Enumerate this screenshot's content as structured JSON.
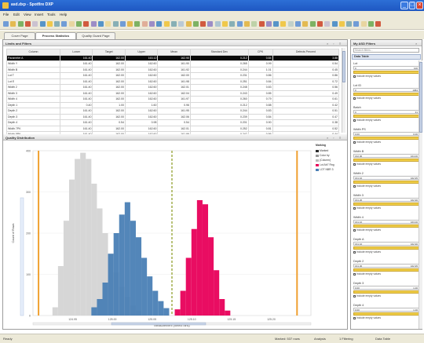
{
  "window": {
    "title": "asd.dxp - Spotfire DXP",
    "min": "_",
    "max": "□",
    "close": "×"
  },
  "menu": [
    "File",
    "Edit",
    "View",
    "Insert",
    "Tools",
    "Help"
  ],
  "tabs": [
    {
      "label": "Cover Page",
      "active": false
    },
    {
      "label": "Process Statistics",
      "active": true
    },
    {
      "label": "Quality Guard Page",
      "active": false
    }
  ],
  "table_panel": {
    "title": "Limits and Filters",
    "controls": [
      "×",
      "▫",
      "≡"
    ],
    "columns": [
      "Column",
      "Lower",
      "Target",
      "Upper",
      "Mean",
      "Standard Dev",
      "CPK",
      "Defects Percent"
    ],
    "rows": [
      [
        "Parameter A",
        "161.40",
        "162.00",
        "163.12",
        "162.90",
        "0.212",
        "0.84",
        "3.88"
      ],
      [
        "Width Y",
        "161.40",
        "162.00",
        "162.60",
        "161.90",
        "0.265",
        "0.99",
        "0.54"
      ],
      [
        "Width B",
        "161.40",
        "162.00",
        "162.60",
        "161.92",
        "0.244",
        "1.01",
        "0.45"
      ],
      [
        "Lot T",
        "161.40",
        "162.00",
        "162.60",
        "162.00",
        "0.231",
        "0.86",
        "0.86"
      ],
      [
        "Lot E",
        "161.40",
        "162.00",
        "162.60",
        "161.98",
        "0.251",
        "0.84",
        "0.72"
      ],
      [
        "Width 2",
        "161.40",
        "162.00",
        "162.60",
        "162.01",
        "0.248",
        "0.83",
        "0.56"
      ],
      [
        "Width 3",
        "161.40",
        "162.00",
        "162.60",
        "162.04",
        "0.243",
        "0.85",
        "0.49"
      ],
      [
        "Width 4",
        "161.40",
        "162.00",
        "162.60",
        "161.97",
        "0.260",
        "0.79",
        "0.61"
      ],
      [
        "Depth 1",
        "0.40",
        "1.00",
        "1.60",
        "0.96",
        "0.212",
        "0.88",
        "0.42"
      ],
      [
        "Depth 2",
        "161.40",
        "162.00",
        "162.60",
        "161.95",
        "0.244",
        "0.83",
        "0.51"
      ],
      [
        "Depth 3",
        "161.40",
        "162.00",
        "162.60",
        "162.06",
        "0.239",
        "0.84",
        "0.47"
      ],
      [
        "Depth 4",
        "161.40",
        "0.54",
        "0.98",
        "0.54",
        "0.201",
        "0.90",
        "0.38"
      ],
      [
        "Width 7PK",
        "161.40",
        "162.00",
        "162.60",
        "162.01",
        "0.252",
        "0.81",
        "0.52"
      ],
      [
        "Width 8PK",
        "161.40",
        "162.00",
        "162.60",
        "161.99",
        "0.247",
        "0.86",
        "0.44"
      ]
    ]
  },
  "chart_panel": {
    "title": "Quality Distribution",
    "controls": [
      "×",
      "▫",
      "≡"
    ],
    "ylabel": "Count of Rows",
    "xlabel": "Measurement (Select bins)",
    "legend_title": "Marking",
    "legend": [
      {
        "label": "Marked",
        "color": "#2b2b2b"
      },
      {
        "label": "Color by",
        "color": "#999999"
      },
      {
        "label": "(Column)",
        "color": "#bbbbbb"
      },
      {
        "label": "Lot Ab7 Rng",
        "color": "#e8005a"
      },
      {
        "label": "LOT NBR 3",
        "color": "#4a7fb5"
      }
    ]
  },
  "chart_data": {
    "type": "bar",
    "xlabel": "Measurement (Select bins)",
    "ylabel": "Count of Rows",
    "xlim": [
      0,
      100
    ],
    "ylim": [
      0,
      400
    ],
    "x_ticks": [
      "124.95",
      "125.00",
      "125.05",
      "125.10",
      "125.15",
      "125.20"
    ],
    "y_ticks": [
      "0",
      "100",
      "200",
      "300",
      "400"
    ],
    "reference_lines": [
      {
        "name": "Lower limit",
        "x": 2,
        "color": "#f0a030",
        "style": "solid"
      },
      {
        "name": "Target",
        "x": 50,
        "color": "#8a9a20",
        "style": "dashed"
      },
      {
        "name": "Upper limit",
        "x": 95,
        "color": "#f0a030",
        "style": "solid"
      }
    ],
    "series": [
      {
        "name": "Gray",
        "color": "#d6d6d6",
        "bins": [
          [
            8,
            20
          ],
          [
            10,
            120
          ],
          [
            12,
            230
          ],
          [
            14,
            330
          ],
          [
            16,
            380
          ],
          [
            18,
            395
          ],
          [
            20,
            380
          ],
          [
            22,
            320
          ],
          [
            24,
            260
          ],
          [
            26,
            200
          ],
          [
            28,
            150
          ],
          [
            30,
            105
          ],
          [
            32,
            70
          ],
          [
            34,
            45
          ],
          [
            36,
            25
          ],
          [
            38,
            12
          ]
        ]
      },
      {
        "name": "Blue",
        "color": "#4a7fb5",
        "bins": [
          [
            22,
            20
          ],
          [
            24,
            40
          ],
          [
            26,
            80
          ],
          [
            28,
            150
          ],
          [
            30,
            200
          ],
          [
            32,
            245
          ],
          [
            34,
            275
          ],
          [
            36,
            230
          ],
          [
            38,
            190
          ],
          [
            40,
            140
          ],
          [
            42,
            95
          ],
          [
            44,
            60
          ],
          [
            46,
            35
          ],
          [
            48,
            18
          ]
        ]
      },
      {
        "name": "Pink",
        "color": "#e8005a",
        "bins": [
          [
            52,
            15
          ],
          [
            54,
            60
          ],
          [
            56,
            140
          ],
          [
            58,
            210
          ],
          [
            60,
            280
          ],
          [
            62,
            270
          ],
          [
            64,
            190
          ],
          [
            66,
            110
          ],
          [
            68,
            40
          ],
          [
            70,
            12
          ]
        ]
      }
    ]
  },
  "filter_panel": {
    "title": "My ASD Filters",
    "search_placeholder": "Search filters...",
    "group": "Data Table",
    "filters": [
      {
        "label": "Lot",
        "lo": "0",
        "hi": "100",
        "check": "Include empty values"
      },
      {
        "label": "Lot ID",
        "lo": "0",
        "hi": "1984",
        "check": "Include empty values"
      },
      {
        "label": "Batch",
        "lo": "0",
        "hi": "31",
        "check": "Include empty values"
      },
      {
        "label": "Width PS",
        "lo": "0.00",
        "hi": "0.00",
        "check": "Include empty values"
      },
      {
        "label": "Width B",
        "lo": "162.00",
        "hi": "164.00",
        "check": "Include empty values"
      },
      {
        "label": "Width 2",
        "lo": "161.10",
        "hi": "162.95",
        "check": "Include empty values"
      },
      {
        "label": "Width 3",
        "lo": "161.20",
        "hi": "162.90",
        "check": "Include empty values"
      },
      {
        "label": "Width 4",
        "lo": "161.10",
        "hi": "163.00",
        "check": "Include empty values"
      },
      {
        "label": "Depth A",
        "lo": "161.10",
        "hi": "162.90",
        "check": "Include empty values"
      },
      {
        "label": "Depth 2",
        "lo": "161.30",
        "hi": "162.95",
        "check": "Include empty values"
      },
      {
        "label": "Depth 3",
        "lo": "0.00",
        "hi": "1.00",
        "check": "Include empty values"
      },
      {
        "label": "Depth 4",
        "lo": "0.00",
        "hi": "1.00",
        "check": "Include empty values"
      }
    ]
  },
  "status": {
    "left": "Ready",
    "items": [
      "Marked: 537 rows",
      "Analysis",
      "1 Filtering",
      "Data Table"
    ]
  }
}
